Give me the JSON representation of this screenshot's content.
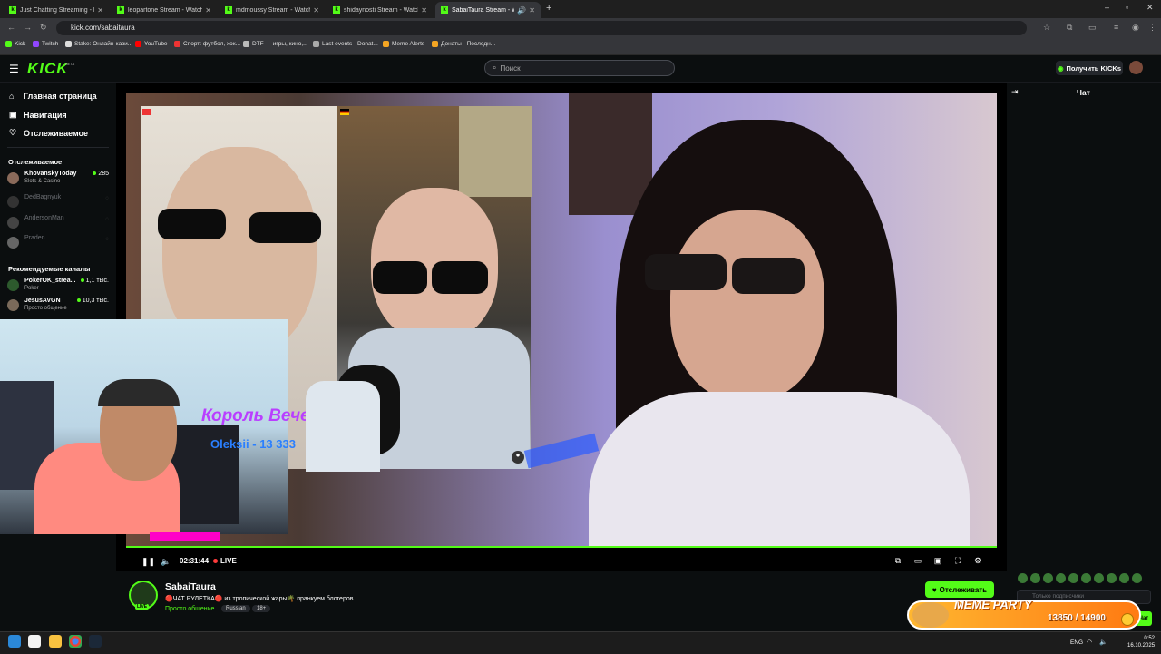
{
  "browser": {
    "tabs": [
      {
        "title": "Just Chatting Streaming - Live S",
        "active": false
      },
      {
        "title": "leopartone Stream - Watch Live",
        "active": false
      },
      {
        "title": "mdmoussy Stream - Watch Live",
        "active": false
      },
      {
        "title": "shidaynosti Stream - Watch Live",
        "active": false
      },
      {
        "title": "SabaiTaura Stream - Watch Live",
        "active": true
      }
    ],
    "url": "kick.com/sabaitaura",
    "bookmarks": [
      "Kick",
      "Twitch",
      "Stake: Онлайн-кази...",
      "YouTube",
      "Спорт: футбол, хок...",
      "DTF — игры, кино,...",
      "Last events - Donat...",
      "Meme Alerts",
      "Донаты - Последн..."
    ]
  },
  "header": {
    "logo": "KICK",
    "logo_badge": "BETA",
    "search_placeholder": "Поиск",
    "get_kicks": "Получить KICKs"
  },
  "sidebar": {
    "nav": [
      "Главная страница",
      "Навигация",
      "Отслеживаемое"
    ],
    "following_title": "Отслеживаемое",
    "following": [
      {
        "name": "KhovanskyToday",
        "category": "Slots & Casino",
        "viewers": "285",
        "live": true
      },
      {
        "name": "DedBagnyuk",
        "live": false
      },
      {
        "name": "AndersonMan",
        "live": false
      },
      {
        "name": "Praden",
        "live": false
      }
    ],
    "recommended_title": "Рекомендуемые каналы",
    "recommended": [
      {
        "name": "PokerOK_strea...",
        "category": "Poker",
        "viewers": "1,1 тыс."
      },
      {
        "name": "JesusAVGN",
        "category": "Просто общение",
        "viewers": "10,3 тыс."
      }
    ]
  },
  "player": {
    "time": "02:31:44",
    "live_label": "LIVE",
    "overlay_title": "Король Вечера",
    "overlay_sub": "Oleksii - 13 333"
  },
  "stream": {
    "name": "SabaiTaura",
    "title": "🔴ЧАТ РУЛЕТКА🔴 из тропической жары🌴 пранкуем блогеров",
    "category": "Просто общение",
    "tags": [
      "Russian",
      "18+"
    ],
    "follow_label": "Отслеживать",
    "live_badge": "LIVE"
  },
  "chat": {
    "title": "Чат",
    "input_placeholder": "Только подписчики",
    "send_label": "Чат"
  },
  "meme_widget": {
    "title": "MEME PARTY",
    "count": "13850 / 14900"
  },
  "taskbar": {
    "lang": "ENG",
    "time": "0:52",
    "date": "16.10.2025"
  },
  "colors": {
    "accent": "#53fc18",
    "background": "#0b0e0f"
  }
}
